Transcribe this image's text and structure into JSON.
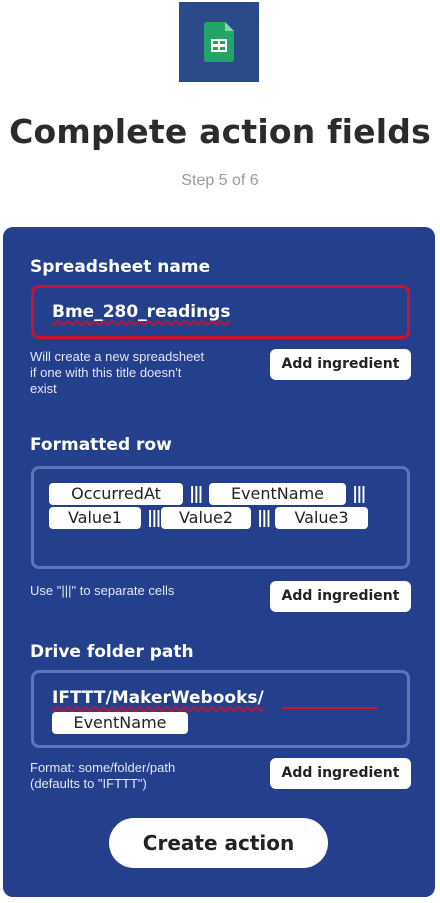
{
  "app": {
    "icon": "google-sheets-icon",
    "icon_bg": "#2a4a8a",
    "accent": "#243f8c",
    "highlight": "#d0112b"
  },
  "header": {
    "title": "Complete action fields",
    "step": "Step 5 of 6"
  },
  "spreadsheet": {
    "label": "Spreadsheet name",
    "value": "Bme_280_readings",
    "help": [
      "Will create a new spreadsheet",
      "if one with this title doesn't",
      "exist"
    ],
    "add_label": "Add ingredient"
  },
  "row": {
    "label": "Formatted row",
    "ingredients": [
      "OccurredAt",
      "EventName",
      "Value1",
      "Value2",
      "Value3"
    ],
    "separator": "|||",
    "help": "Use \"|||\" to separate cells",
    "add_label": "Add ingredient"
  },
  "folder": {
    "label": "Drive folder path",
    "value": "IFTTT/MakerWebooks/",
    "ingredient": "EventName",
    "help": [
      "Format: some/folder/path",
      "(defaults to \"IFTTT\")"
    ],
    "add_label": "Add ingredient"
  },
  "create_label": "Create action"
}
